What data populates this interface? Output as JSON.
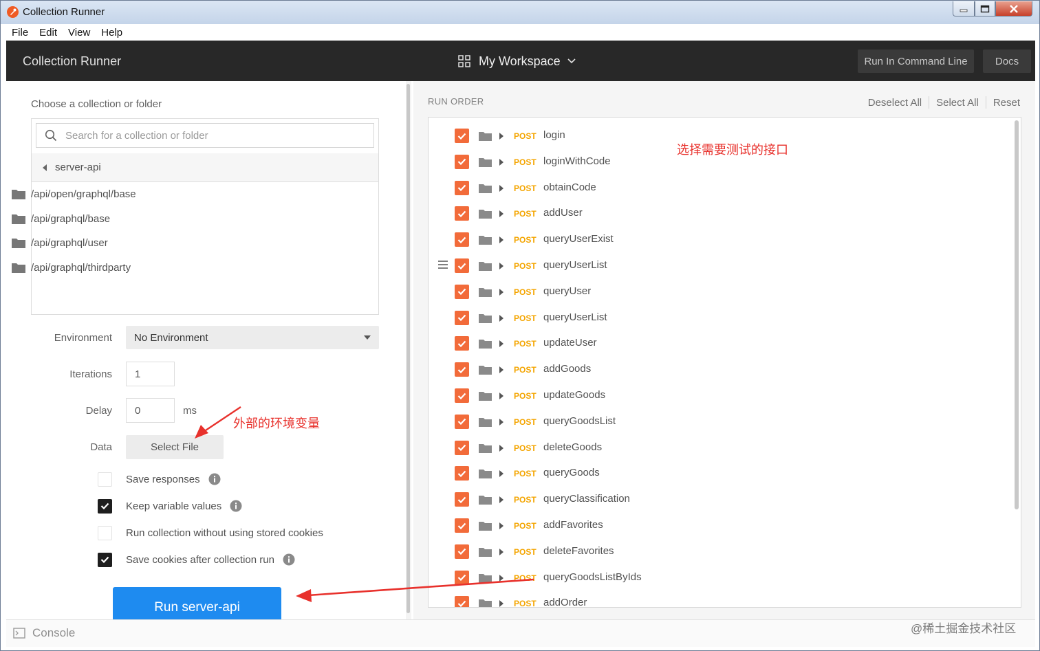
{
  "window": {
    "title": "Collection Runner"
  },
  "menu": [
    "File",
    "Edit",
    "View",
    "Help"
  ],
  "header": {
    "title": "Collection Runner",
    "workspace": "My Workspace",
    "run_cmd_label": "Run In Command Line",
    "docs_label": "Docs"
  },
  "left": {
    "choose_label": "Choose a collection or folder",
    "search_placeholder": "Search for a collection or folder",
    "breadcrumb": "server-api",
    "folders": [
      "/api/open/graphql/base",
      "/api/graphql/base",
      "/api/graphql/user",
      "/api/graphql/thirdparty"
    ],
    "environment_label": "Environment",
    "environment_value": "No Environment",
    "iterations_label": "Iterations",
    "iterations_value": "1",
    "delay_label": "Delay",
    "delay_value": "0",
    "delay_unit": "ms",
    "data_label": "Data",
    "select_file_label": "Select File",
    "options": [
      {
        "label": "Save responses",
        "checked": false,
        "info": true
      },
      {
        "label": "Keep variable values",
        "checked": true,
        "info": true
      },
      {
        "label": "Run collection without using stored cookies",
        "checked": false,
        "info": false
      },
      {
        "label": "Save cookies after collection run",
        "checked": true,
        "info": true
      }
    ],
    "run_button": "Run server-api"
  },
  "right": {
    "run_order_label": "RUN ORDER",
    "deselect_all": "Deselect All",
    "select_all": "Select All",
    "reset": "Reset",
    "requests": [
      {
        "method": "POST",
        "name": "login"
      },
      {
        "method": "POST",
        "name": "loginWithCode"
      },
      {
        "method": "POST",
        "name": "obtainCode"
      },
      {
        "method": "POST",
        "name": "addUser"
      },
      {
        "method": "POST",
        "name": "queryUserExist"
      },
      {
        "method": "POST",
        "name": "queryUserList"
      },
      {
        "method": "POST",
        "name": "queryUser"
      },
      {
        "method": "POST",
        "name": "queryUserList"
      },
      {
        "method": "POST",
        "name": "updateUser"
      },
      {
        "method": "POST",
        "name": "addGoods"
      },
      {
        "method": "POST",
        "name": "updateGoods"
      },
      {
        "method": "POST",
        "name": "queryGoodsList"
      },
      {
        "method": "POST",
        "name": "deleteGoods"
      },
      {
        "method": "POST",
        "name": "queryGoods"
      },
      {
        "method": "POST",
        "name": "queryClassification"
      },
      {
        "method": "POST",
        "name": "addFavorites"
      },
      {
        "method": "POST",
        "name": "deleteFavorites"
      },
      {
        "method": "POST",
        "name": "queryGoodsListByIds"
      },
      {
        "method": "POST",
        "name": "addOrder"
      }
    ]
  },
  "annotations": {
    "select_api": "选择需要测试的接口",
    "env_vars": "外部的环境变量"
  },
  "status": {
    "console_label": "Console"
  },
  "watermark": "@稀土掘金技术社区",
  "colors": {
    "accent_orange": "#f26b3a",
    "method_post": "#f4a500",
    "run_button": "#1e8bf0",
    "header_bg": "#282828",
    "annotation_red": "#e8312c"
  }
}
